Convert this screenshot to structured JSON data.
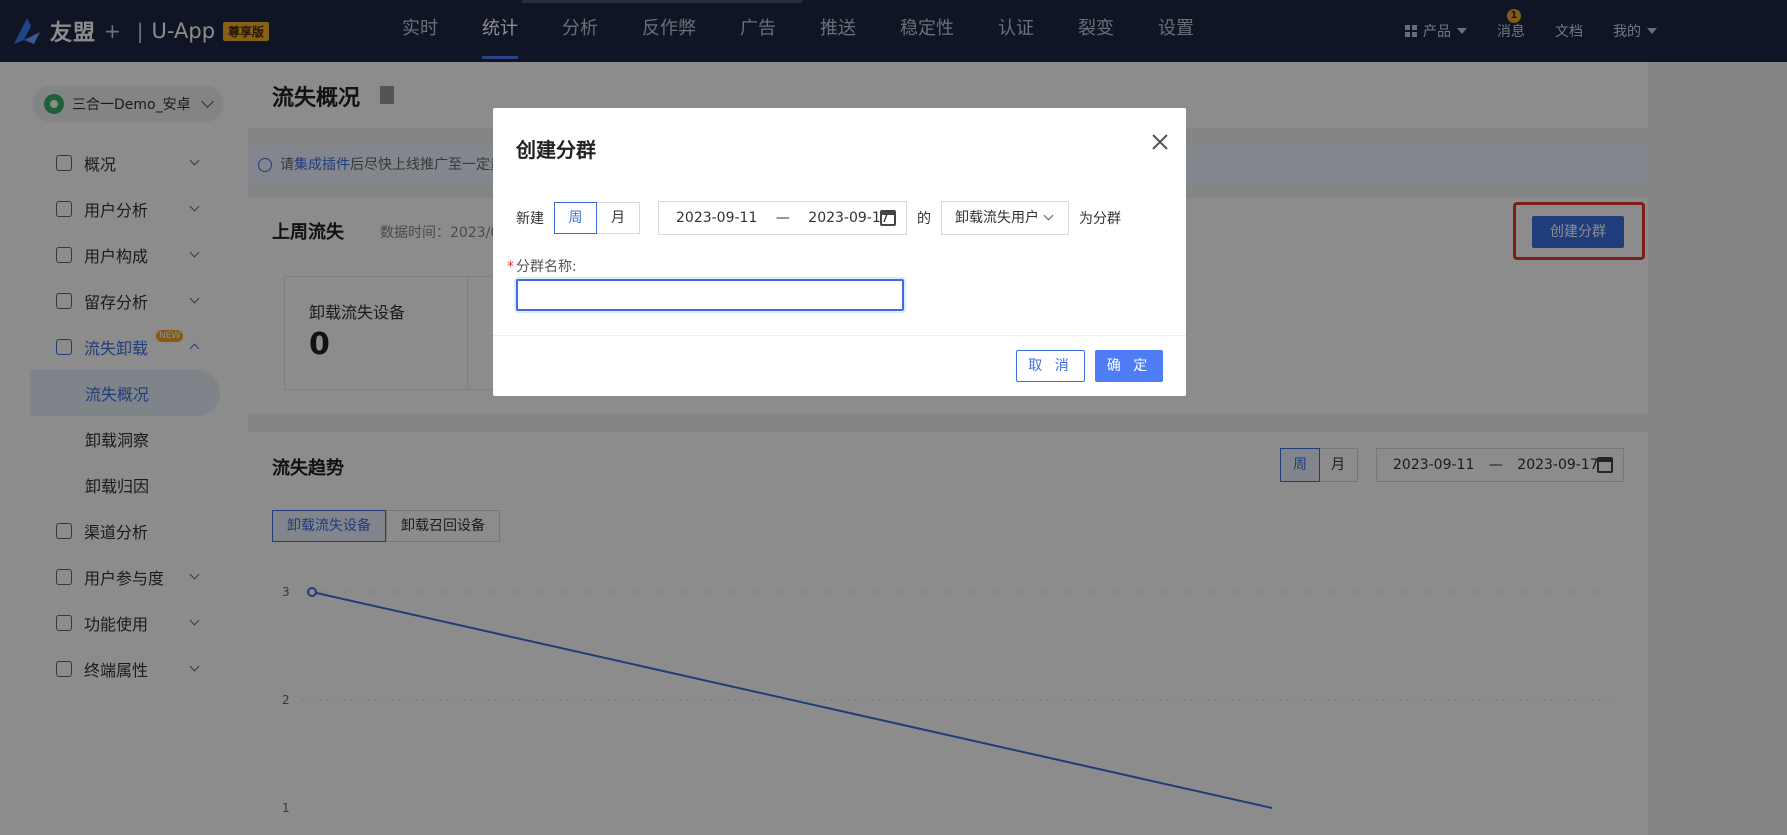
{
  "topnav": {
    "logo_text": "友盟",
    "logo_plus": "+",
    "logo_sep": "|",
    "logo_app": "U-App",
    "logo_badge": "尊享版",
    "items": [
      {
        "label": "实时"
      },
      {
        "label": "统计"
      },
      {
        "label": "分析"
      },
      {
        "label": "反作弊"
      },
      {
        "label": "广告"
      },
      {
        "label": "推送"
      },
      {
        "label": "稳定性"
      },
      {
        "label": "认证"
      },
      {
        "label": "裂变"
      },
      {
        "label": "设置"
      }
    ],
    "active_item": "统计",
    "right": {
      "product_label": "产品",
      "message_label": "消息",
      "message_count": "1",
      "docs_label": "文档",
      "mine_label": "我的"
    },
    "colors": {
      "background": "#1c2742",
      "accent": "#4e7cf6",
      "badge": "#f5a623"
    }
  },
  "sidebar": {
    "app_selector": "三合一Demo_安卓",
    "menu": [
      {
        "label": "概况",
        "icon": "chart-icon"
      },
      {
        "label": "用户分析",
        "icon": "user-analysis-icon"
      },
      {
        "label": "用户构成",
        "icon": "user-composition-icon"
      },
      {
        "label": "留存分析",
        "icon": "retention-icon"
      },
      {
        "label": "流失卸载",
        "icon": "churn-icon",
        "badge": "NEW"
      },
      {
        "label": "渠道分析",
        "icon": "channel-icon"
      },
      {
        "label": "用户参与度",
        "icon": "engagement-icon"
      },
      {
        "label": "功能使用",
        "icon": "feature-icon"
      },
      {
        "label": "终端属性",
        "icon": "device-icon"
      }
    ],
    "submenu": [
      {
        "label": "流失概况"
      },
      {
        "label": "卸载洞察"
      },
      {
        "label": "卸载归因"
      }
    ]
  },
  "main": {
    "page_title": "流失概况",
    "notice": {
      "prefix": "请",
      "link": "集成插件",
      "suffix": "后尽快上线推广至一定量"
    },
    "last_week": {
      "title": "上周流失",
      "meta": "数据时间：2023/0",
      "stat_label": "卸载流失设备",
      "stat_value": "0",
      "create_group_label": "创建分群"
    },
    "trend": {
      "title": "流失趋势",
      "period_week": "周",
      "period_month": "月",
      "date_start": "2023-09-11",
      "date_sep": "—",
      "date_end": "2023-09-17",
      "tab_uninstall": "卸载流失设备",
      "tab_recall": "卸载召回设备"
    }
  },
  "chart_data": {
    "type": "line",
    "y_ticks": [
      "3",
      "2",
      "1"
    ],
    "series": [
      {
        "values": [
          3,
          1
        ]
      }
    ],
    "ylim": [
      1,
      3
    ]
  },
  "modal": {
    "title": "创建分群",
    "new_label": "新建",
    "week": "周",
    "month": "月",
    "date_start": "2023-09-11",
    "date_sep": "—",
    "date_end": "2023-09-17",
    "of_label": "的",
    "user_type": "卸载流失用户",
    "as_group": "为分群",
    "field_required": "*",
    "field_label": "分群名称:",
    "name_value": "",
    "cancel": "取 消",
    "confirm": "确 定"
  }
}
